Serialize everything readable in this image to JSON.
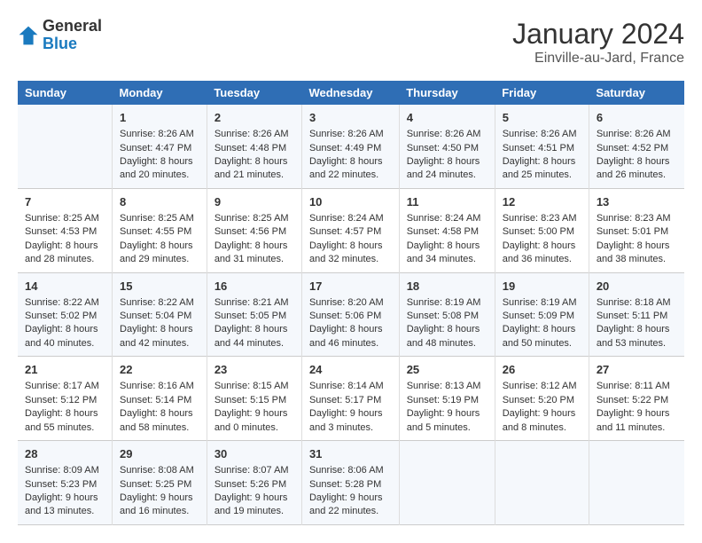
{
  "header": {
    "logo_general": "General",
    "logo_blue": "Blue",
    "title": "January 2024",
    "subtitle": "Einville-au-Jard, France"
  },
  "days_of_week": [
    "Sunday",
    "Monday",
    "Tuesday",
    "Wednesday",
    "Thursday",
    "Friday",
    "Saturday"
  ],
  "weeks": [
    [
      {
        "day": "",
        "info": ""
      },
      {
        "day": "1",
        "info": "Sunrise: 8:26 AM\nSunset: 4:47 PM\nDaylight: 8 hours\nand 20 minutes."
      },
      {
        "day": "2",
        "info": "Sunrise: 8:26 AM\nSunset: 4:48 PM\nDaylight: 8 hours\nand 21 minutes."
      },
      {
        "day": "3",
        "info": "Sunrise: 8:26 AM\nSunset: 4:49 PM\nDaylight: 8 hours\nand 22 minutes."
      },
      {
        "day": "4",
        "info": "Sunrise: 8:26 AM\nSunset: 4:50 PM\nDaylight: 8 hours\nand 24 minutes."
      },
      {
        "day": "5",
        "info": "Sunrise: 8:26 AM\nSunset: 4:51 PM\nDaylight: 8 hours\nand 25 minutes."
      },
      {
        "day": "6",
        "info": "Sunrise: 8:26 AM\nSunset: 4:52 PM\nDaylight: 8 hours\nand 26 minutes."
      }
    ],
    [
      {
        "day": "7",
        "info": "Sunrise: 8:25 AM\nSunset: 4:53 PM\nDaylight: 8 hours\nand 28 minutes."
      },
      {
        "day": "8",
        "info": "Sunrise: 8:25 AM\nSunset: 4:55 PM\nDaylight: 8 hours\nand 29 minutes."
      },
      {
        "day": "9",
        "info": "Sunrise: 8:25 AM\nSunset: 4:56 PM\nDaylight: 8 hours\nand 31 minutes."
      },
      {
        "day": "10",
        "info": "Sunrise: 8:24 AM\nSunset: 4:57 PM\nDaylight: 8 hours\nand 32 minutes."
      },
      {
        "day": "11",
        "info": "Sunrise: 8:24 AM\nSunset: 4:58 PM\nDaylight: 8 hours\nand 34 minutes."
      },
      {
        "day": "12",
        "info": "Sunrise: 8:23 AM\nSunset: 5:00 PM\nDaylight: 8 hours\nand 36 minutes."
      },
      {
        "day": "13",
        "info": "Sunrise: 8:23 AM\nSunset: 5:01 PM\nDaylight: 8 hours\nand 38 minutes."
      }
    ],
    [
      {
        "day": "14",
        "info": "Sunrise: 8:22 AM\nSunset: 5:02 PM\nDaylight: 8 hours\nand 40 minutes."
      },
      {
        "day": "15",
        "info": "Sunrise: 8:22 AM\nSunset: 5:04 PM\nDaylight: 8 hours\nand 42 minutes."
      },
      {
        "day": "16",
        "info": "Sunrise: 8:21 AM\nSunset: 5:05 PM\nDaylight: 8 hours\nand 44 minutes."
      },
      {
        "day": "17",
        "info": "Sunrise: 8:20 AM\nSunset: 5:06 PM\nDaylight: 8 hours\nand 46 minutes."
      },
      {
        "day": "18",
        "info": "Sunrise: 8:19 AM\nSunset: 5:08 PM\nDaylight: 8 hours\nand 48 minutes."
      },
      {
        "day": "19",
        "info": "Sunrise: 8:19 AM\nSunset: 5:09 PM\nDaylight: 8 hours\nand 50 minutes."
      },
      {
        "day": "20",
        "info": "Sunrise: 8:18 AM\nSunset: 5:11 PM\nDaylight: 8 hours\nand 53 minutes."
      }
    ],
    [
      {
        "day": "21",
        "info": "Sunrise: 8:17 AM\nSunset: 5:12 PM\nDaylight: 8 hours\nand 55 minutes."
      },
      {
        "day": "22",
        "info": "Sunrise: 8:16 AM\nSunset: 5:14 PM\nDaylight: 8 hours\nand 58 minutes."
      },
      {
        "day": "23",
        "info": "Sunrise: 8:15 AM\nSunset: 5:15 PM\nDaylight: 9 hours\nand 0 minutes."
      },
      {
        "day": "24",
        "info": "Sunrise: 8:14 AM\nSunset: 5:17 PM\nDaylight: 9 hours\nand 3 minutes."
      },
      {
        "day": "25",
        "info": "Sunrise: 8:13 AM\nSunset: 5:19 PM\nDaylight: 9 hours\nand 5 minutes."
      },
      {
        "day": "26",
        "info": "Sunrise: 8:12 AM\nSunset: 5:20 PM\nDaylight: 9 hours\nand 8 minutes."
      },
      {
        "day": "27",
        "info": "Sunrise: 8:11 AM\nSunset: 5:22 PM\nDaylight: 9 hours\nand 11 minutes."
      }
    ],
    [
      {
        "day": "28",
        "info": "Sunrise: 8:09 AM\nSunset: 5:23 PM\nDaylight: 9 hours\nand 13 minutes."
      },
      {
        "day": "29",
        "info": "Sunrise: 8:08 AM\nSunset: 5:25 PM\nDaylight: 9 hours\nand 16 minutes."
      },
      {
        "day": "30",
        "info": "Sunrise: 8:07 AM\nSunset: 5:26 PM\nDaylight: 9 hours\nand 19 minutes."
      },
      {
        "day": "31",
        "info": "Sunrise: 8:06 AM\nSunset: 5:28 PM\nDaylight: 9 hours\nand 22 minutes."
      },
      {
        "day": "",
        "info": ""
      },
      {
        "day": "",
        "info": ""
      },
      {
        "day": "",
        "info": ""
      }
    ]
  ]
}
